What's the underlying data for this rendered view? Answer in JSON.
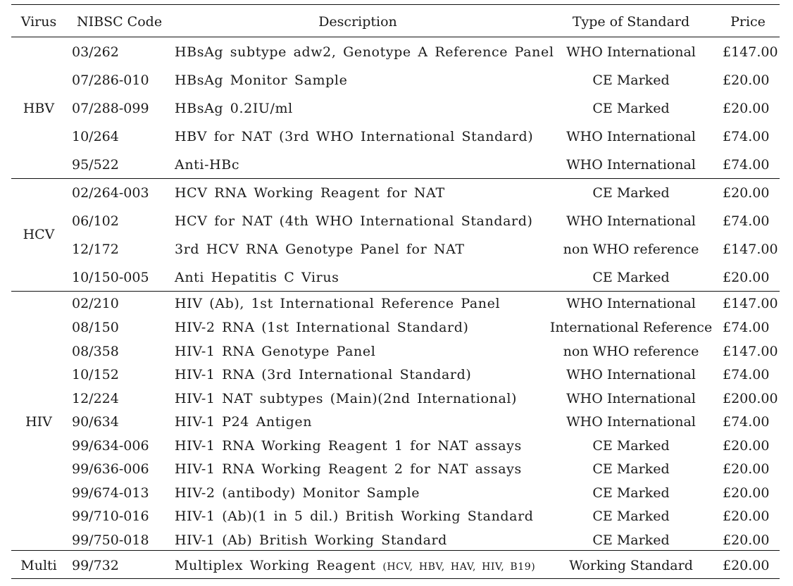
{
  "table": {
    "headers": {
      "virus": "Virus",
      "code": "NIBSC Code",
      "description": "Description",
      "type": "Type of Standard",
      "price": "Price"
    },
    "groups": [
      {
        "virus": "HBV",
        "rows": [
          {
            "code": "03/262",
            "description": "HBsAg subtype adw2, Genotype A Reference Panel",
            "type": "WHO International",
            "price": "£147.00"
          },
          {
            "code": "07/286-010",
            "description": "HBsAg Monitor Sample",
            "type": "CE Marked",
            "price": "£20.00"
          },
          {
            "code": "07/288-099",
            "description": "HBsAg 0.2IU/ml",
            "type": "CE Marked",
            "price": "£20.00"
          },
          {
            "code": "10/264",
            "description": "HBV for NAT (3rd WHO International Standard)",
            "type": "WHO International",
            "price": "£74.00"
          },
          {
            "code": "95/522",
            "description": "Anti-HBc",
            "type": "WHO International",
            "price": "£74.00"
          }
        ]
      },
      {
        "virus": "HCV",
        "rows": [
          {
            "code": "02/264-003",
            "description": "HCV RNA Working Reagent for NAT",
            "type": "CE Marked",
            "price": "£20.00"
          },
          {
            "code": "06/102",
            "description": "HCV for NAT (4th WHO International Standard)",
            "type": "WHO International",
            "price": "£74.00"
          },
          {
            "code": "12/172",
            "description": "3rd HCV RNA Genotype Panel for NAT",
            "type": "non WHO reference",
            "price": "£147.00"
          },
          {
            "code": "10/150-005",
            "description": "Anti Hepatitis C Virus",
            "type": "CE Marked",
            "price": "£20.00"
          }
        ]
      },
      {
        "virus": "HIV",
        "rows": [
          {
            "code": "02/210",
            "description": "HIV (Ab), 1st International Reference Panel",
            "type": "WHO International",
            "price": "£147.00"
          },
          {
            "code": "08/150",
            "description": "HIV-2 RNA (1st International Standard)",
            "type": "International Reference",
            "price": "£74.00"
          },
          {
            "code": "08/358",
            "description": "HIV-1 RNA Genotype Panel",
            "type": "non WHO reference",
            "price": "£147.00"
          },
          {
            "code": "10/152",
            "description": "HIV-1 RNA (3rd International Standard)",
            "type": "WHO International",
            "price": "£74.00"
          },
          {
            "code": "12/224",
            "description": "HIV-1 NAT subtypes (Main)(2nd International)",
            "type": "WHO International",
            "price": "£200.00"
          },
          {
            "code": "90/634",
            "description": "HIV-1 P24 Antigen",
            "type": "WHO International",
            "price": "£74.00"
          },
          {
            "code": "99/634-006",
            "description": "HIV-1 RNA Working Reagent 1 for NAT assays",
            "type": "CE Marked",
            "price": "£20.00"
          },
          {
            "code": "99/636-006",
            "description": "HIV-1 RNA Working Reagent 2 for NAT assays",
            "type": "CE Marked",
            "price": "£20.00"
          },
          {
            "code": "99/674-013",
            "description": "HIV-2 (antibody) Monitor Sample",
            "type": "CE Marked",
            "price": "£20.00"
          },
          {
            "code": "99/710-016",
            "description": "HIV-1 (Ab)(1 in 5 dil.) British Working Standard",
            "type": "CE Marked",
            "price": "£20.00"
          },
          {
            "code": "99/750-018",
            "description": "HIV-1 (Ab) British Working Standard",
            "type": "CE Marked",
            "price": "£20.00"
          }
        ]
      },
      {
        "virus": "Multi",
        "rows": [
          {
            "code": "99/732",
            "description": "Multiplex Working Reagent",
            "description_small": "(HCV, HBV, HAV, HIV, B19)",
            "type": "Working Standard",
            "price": "£20.00"
          }
        ]
      }
    ]
  }
}
